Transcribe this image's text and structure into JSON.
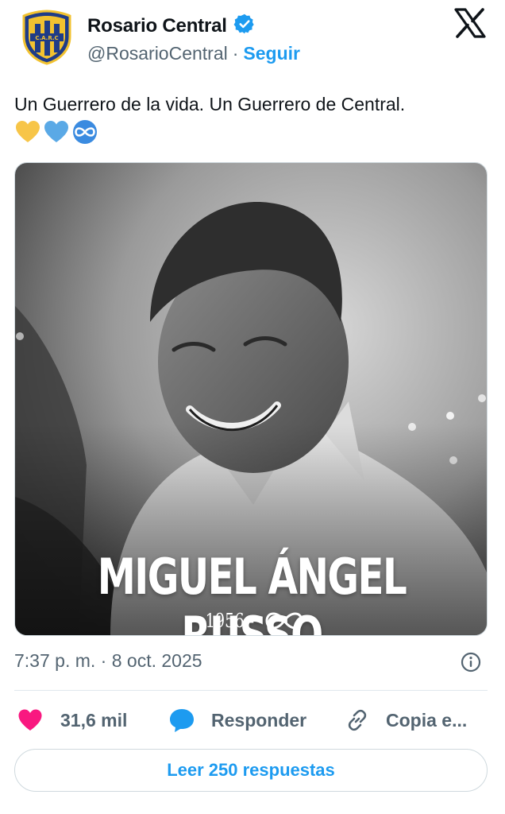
{
  "account": {
    "display_name": "Rosario Central",
    "handle": "@RosarioCentral",
    "separator": "·",
    "follow_label": "Seguir",
    "verified": true,
    "brand_colors": {
      "gold": "#f2c230",
      "navy": "#1f3c88"
    }
  },
  "tweet": {
    "text": "Un Guerrero de la vida. Un Guerrero de Central.",
    "emojis": [
      "yellow-heart-icon",
      "blue-heart-icon",
      "infinity-icon"
    ],
    "timestamp": "7:37 p. m. · 8 oct. 2025"
  },
  "media": {
    "name": "MIGUEL ÁNGEL RUSSO",
    "years_start": "1956 -",
    "years_end_icon": "infinity-icon"
  },
  "actions": {
    "likes": "31,6 mil",
    "reply_label": "Responder",
    "copy_label": "Copia e..."
  },
  "replies_button": "Leer 250 respuestas",
  "colors": {
    "accent": "#1d9bf0",
    "like": "#f91880",
    "text": "#0f1419",
    "muted": "#536471"
  }
}
